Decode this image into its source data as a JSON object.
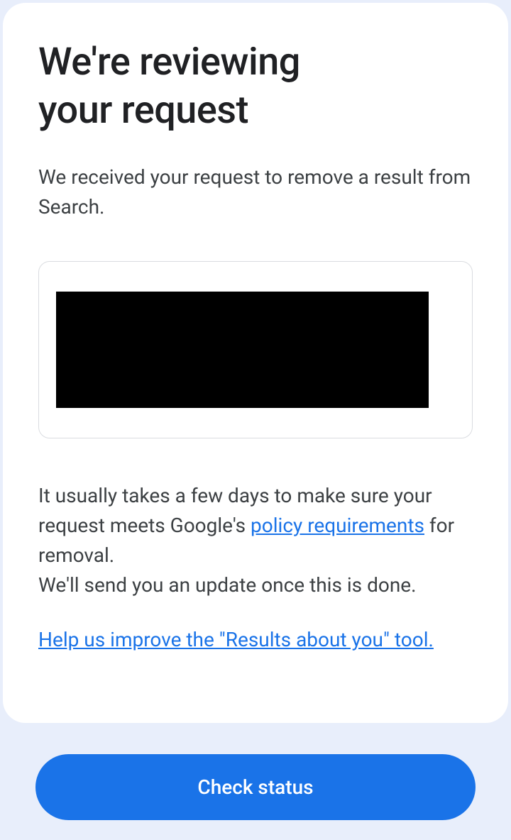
{
  "heading_line1": "We're reviewing",
  "heading_line2": "your request",
  "intro": "We received your request to remove a result from Search.",
  "body_prefix": "It usually takes a few days to make sure your request meets Google's ",
  "policy_link_text": "policy requirements",
  "body_suffix": " for removal.",
  "update_text": "We'll send you an update once this is done.",
  "feedback_link_text": "Help us improve the \"Results about you\" tool.",
  "button_label": "Check status",
  "colors": {
    "primary": "#1a73e8",
    "background": "#e8eefb",
    "card": "#ffffff",
    "text_heading": "#202124",
    "text_body": "#3c4043",
    "border": "#dadce0"
  }
}
